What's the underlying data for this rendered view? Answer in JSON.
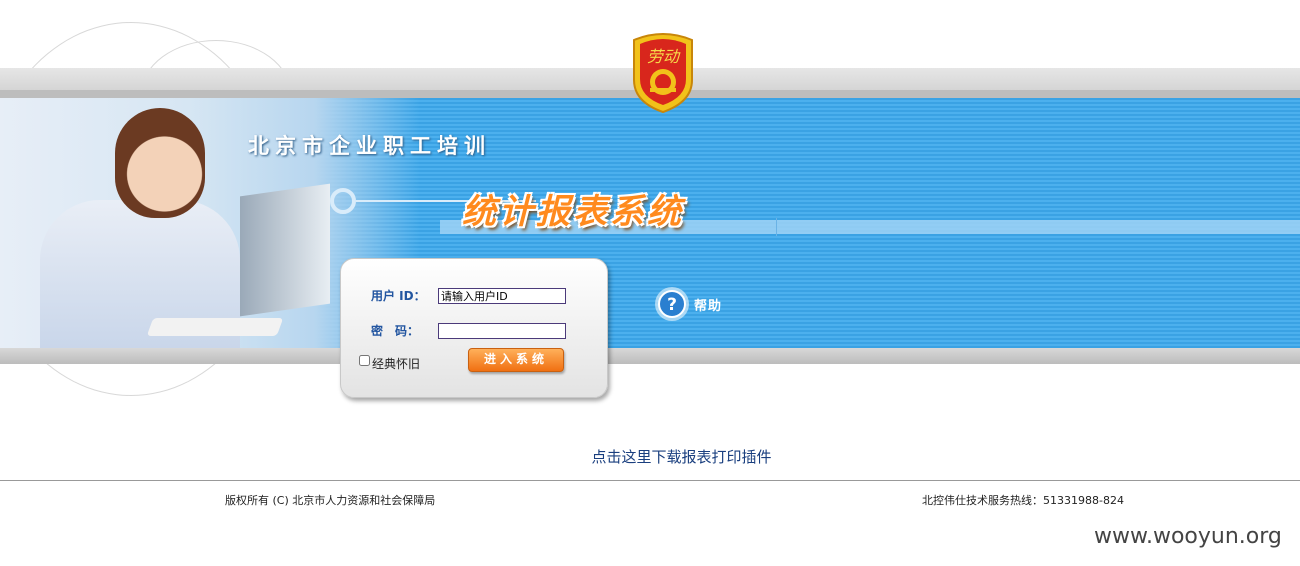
{
  "header": {
    "org_title": "北京市企业职工培训",
    "system_title": "统计报表系统",
    "emblem_text": "劳动"
  },
  "login": {
    "user_label": "用户 ID：",
    "user_value": "请输入用户ID",
    "password_label": "密　码：",
    "password_value": "",
    "classic_label": "经典怀旧",
    "classic_checked": false,
    "submit_label": "进入系统"
  },
  "help": {
    "label": "帮助",
    "icon": "question-icon"
  },
  "download_link": "点击这里下载报表打印插件",
  "footer": {
    "copyright": "版权所有 (C) 北京市人力资源和社会保障局",
    "hotline": "北控伟仕技术服务热线：51331988-824"
  },
  "watermark": "www.wooyun.org",
  "colors": {
    "banner_blue": "#3aa2e4",
    "title_orange": "#ff8a1e",
    "label_blue": "#2255a0",
    "link_blue": "#1a3f7f",
    "button_orange": "#f07012"
  }
}
